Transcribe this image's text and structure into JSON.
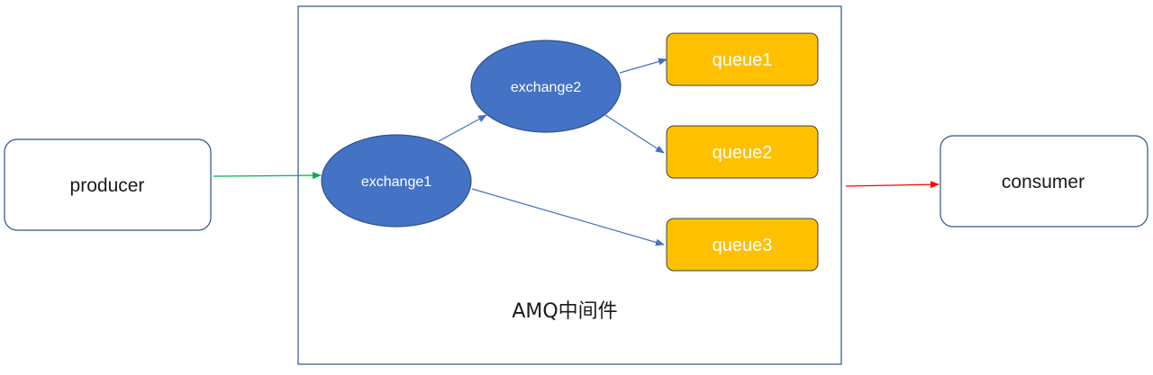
{
  "container": {
    "label": "AMQ中间件"
  },
  "producer": {
    "label": "producer"
  },
  "consumer": {
    "label": "consumer"
  },
  "exchanges": [
    {
      "label": "exchange1"
    },
    {
      "label": "exchange2"
    }
  ],
  "queues": [
    {
      "label": "queue1"
    },
    {
      "label": "queue2"
    },
    {
      "label": "queue3"
    }
  ],
  "colors": {
    "exchange_fill": "#4472c4",
    "exchange_stroke": "#2f528f",
    "queue_fill": "#ffc000",
    "queue_stroke": "#3f3f3f",
    "box_stroke": "#2f528f",
    "arrow_blue": "#4472c4",
    "arrow_green": "#00b050",
    "arrow_red": "#ff0000"
  }
}
